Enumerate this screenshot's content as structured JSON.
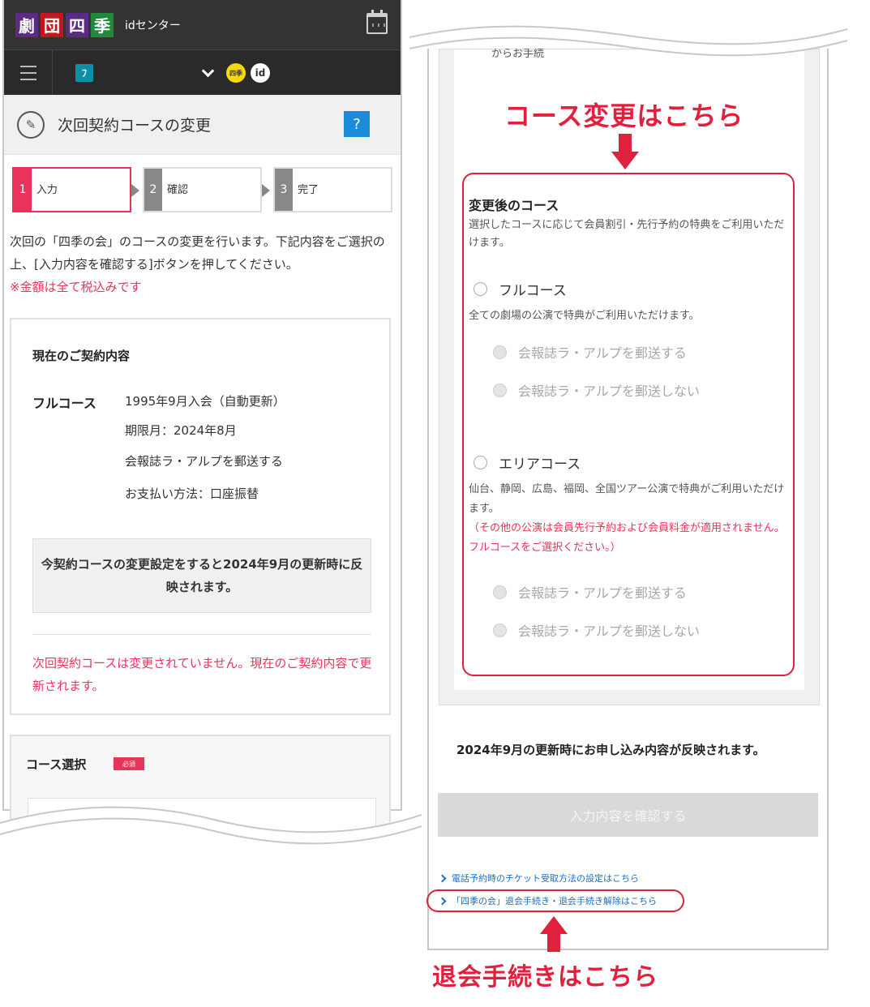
{
  "header": {
    "logo_chars": [
      "劇",
      "団",
      "四",
      "季"
    ],
    "logo_colors": [
      "#5b2a86",
      "#c4161c",
      "#5b2a86",
      "#1f8a3b"
    ],
    "title": "idセンター",
    "calendar_icon": "calendar-icon"
  },
  "nav": {
    "menu_icon": "hamburger-icon",
    "badge_shiki": "四季",
    "badge_id": "id"
  },
  "page": {
    "title": "次回契約コースの変更",
    "help_label": "?"
  },
  "steps": [
    {
      "num": "1",
      "label": "入力"
    },
    {
      "num": "2",
      "label": "確認"
    },
    {
      "num": "3",
      "label": "完了"
    }
  ],
  "intro": {
    "text": "次回の「四季の会」のコースの変更を行います。下記内容をご選択の上、[入力内容を確認する]ボタンを押してください。",
    "note": "※金額は全て税込みです"
  },
  "current": {
    "title": "現在のご契約内容",
    "plan": "フルコース",
    "lines": [
      "1995年9月入会（自動更新）",
      "期限月：2024年8月",
      "会報誌ラ・アルプを郵送する",
      "お支払い方法：口座振替"
    ],
    "notice": "今契約コースの変更設定をすると2024年9月の更新時に反映されます。",
    "warning": "次回契約コースは変更されていません。現在のご契約内容で更新されます。"
  },
  "course_select": {
    "title": "コース選択",
    "required": "必須"
  },
  "right": {
    "cut_text": "からお手続",
    "course_title": "変更後のコース",
    "course_desc": "選択したコースに応じて会員割引・先行予約の特典をご利用いただけます。",
    "full": {
      "label": "フルコース",
      "desc": "全ての劇場の公演で特典がご利用いただけます。",
      "opt1": "会報誌ラ・アルプを郵送する",
      "opt2": "会報誌ラ・アルプを郵送しない"
    },
    "area": {
      "label": "エリアコース",
      "desc": "仙台、静岡、広島、福岡、全国ツアー公演で特典がご利用いただけます。",
      "warn": "（その他の公演は会員先行予約および会員料金が適用されません。フルコースをご選択ください。）",
      "opt1": "会報誌ラ・アルプを郵送する",
      "opt2": "会報誌ラ・アルプを郵送しない"
    },
    "reflect": "2024年9月の更新時にお申し込み内容が反映されます。",
    "confirm_button": "入力内容を確認する",
    "link1": "電話予約時のチケット受取方法の設定はこちら",
    "link2": "「四季の会」退会手続き・退会手続き解除はこちら"
  },
  "annotations": {
    "top": "コース変更はこちら",
    "bottom": "退会手続きはこちら",
    "color": "#e0203c"
  }
}
